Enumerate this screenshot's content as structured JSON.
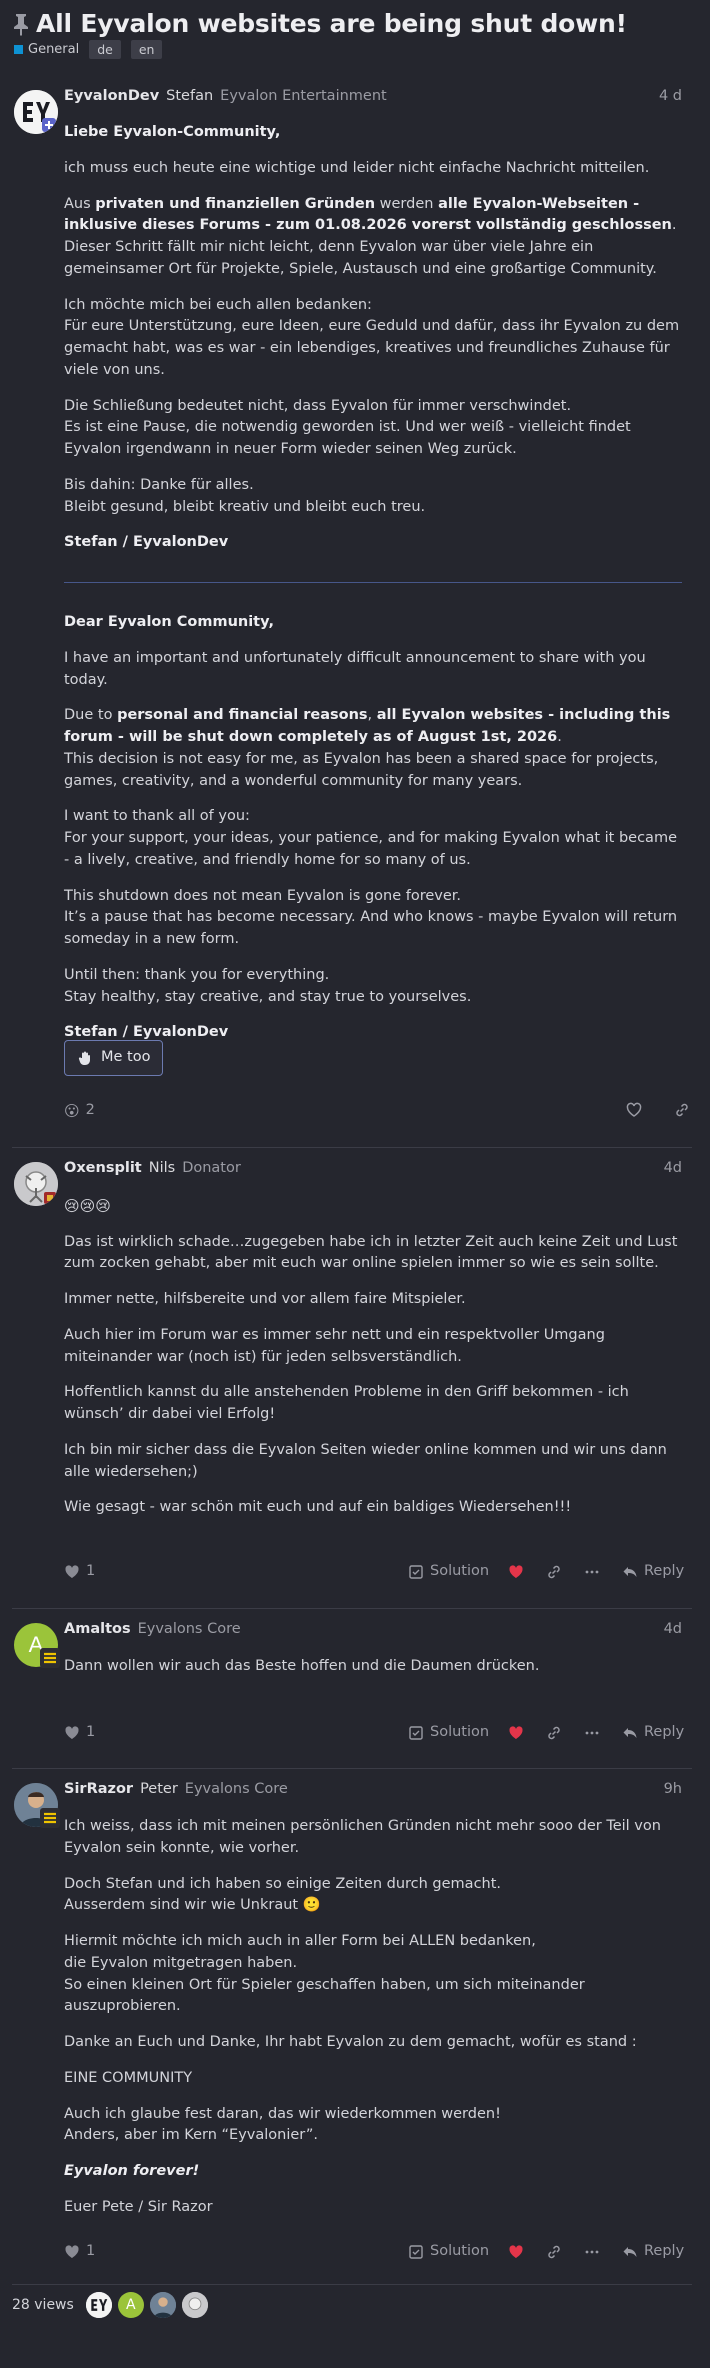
{
  "topic": {
    "title": "All Eyvalon websites are being shut down!",
    "category": "General",
    "tags": [
      "de",
      "en"
    ]
  },
  "posts": [
    {
      "username": "EyvalonDev",
      "realname": "Stefan",
      "group": "Eyvalon Entertainment",
      "date": "4 d",
      "de": {
        "greeting": "Liebe Eyvalon-Community,",
        "p1": "ich muss euch heute eine wichtige und leider nicht einfache Nachricht mitteilen.",
        "p2_a": "Aus ",
        "p2_b": "privaten und finanziellen Gründen",
        "p2_c": " werden ",
        "p2_d": "alle Eyvalon-Webseiten - inklusive dieses Forums - zum 01.08.2026 vorerst vollständig geschlossen",
        "p2_e": ".",
        "p2_f": "Dieser Schritt fällt mir nicht leicht, denn Eyvalon war über viele Jahre ein gemeinsamer Ort für Projekte, Spiele, Austausch und eine großartige Community.",
        "p3_a": "Ich möchte mich bei euch allen bedanken:",
        "p3_b": "Für eure Unterstützung, eure Ideen, eure Geduld und dafür, dass ihr Eyvalon zu dem gemacht habt, was es war - ein lebendiges, kreatives und freundliches Zuhause für viele von uns.",
        "p4_a": "Die Schließung bedeutet nicht, dass Eyvalon für immer verschwindet.",
        "p4_b": "Es ist eine Pause, die notwendig geworden ist. Und wer weiß - vielleicht findet Eyvalon irgendwann in neuer Form wieder seinen Weg zurück.",
        "p5_a": "Bis dahin: Danke für alles.",
        "p5_b": "Bleibt gesund, bleibt kreativ und bleibt euch treu.",
        "sign": "Stefan / EyvalonDev"
      },
      "en": {
        "greeting": "Dear Eyvalon Community,",
        "p1": "I have an important and unfortunately difficult announcement to share with you today.",
        "p2_a": "Due to ",
        "p2_b": "personal and financial reasons",
        "p2_c": ", ",
        "p2_d": "all Eyvalon websites - including this forum - will be shut down completely as of August 1st, 2026",
        "p2_e": ".",
        "p2_f": "This decision is not easy for me, as Eyvalon has been a shared space for projects, games, creativity, and a wonderful community for many years.",
        "p3_a": "I want to thank all of you:",
        "p3_b": "For your support, your ideas, your patience, and for making Eyvalon what it became - a lively, creative, and friendly home for so many of us.",
        "p4_a": "This shutdown does not mean Eyvalon is gone forever.",
        "p4_b": "It’s a pause that has become necessary. And who knows - maybe Eyvalon will return someday in a new form.",
        "p5_a": "Until then: thank you for everything.",
        "p5_b": "Stay healthy, stay creative, and stay true to yourselves.",
        "sign": "Stefan / EyvalonDev"
      },
      "me_too": "Me too",
      "reaction_count": "2"
    },
    {
      "username": "Oxensplit",
      "realname": "Nils",
      "group": "Donator",
      "date": "4d",
      "emojis": "😢😢😢",
      "paragraphs": [
        "Das ist wirklich schade…zugegeben habe ich in letzter Zeit auch keine Zeit und Lust zum zocken gehabt, aber mit euch war online spielen immer so wie es sein sollte.",
        "Immer nette, hilfsbereite und vor allem faire Mitspieler.",
        "Auch hier im Forum war es immer sehr nett und ein respektvoller Umgang miteinander war (noch ist) für jeden selbsverständlich.",
        "Hoffentlich kannst du alle anstehenden Probleme in den Griff bekommen - ich wünsch’ dir dabei viel Erfolg!",
        "Ich bin mir sicher dass die Eyvalon Seiten wieder online kommen und wir uns dann alle wiedersehen;)",
        "Wie gesagt - war schön mit euch und auf ein baldiges Wiedersehen!!!"
      ],
      "likes": "1"
    },
    {
      "username": "Amaltos",
      "realname": "",
      "group": "Eyvalons Core",
      "date": "4d",
      "avatar_letter": "A",
      "paragraphs": [
        "Dann wollen wir auch das Beste hoffen und die Daumen drücken."
      ],
      "likes": "1"
    },
    {
      "username": "SirRazor",
      "realname": "Peter",
      "group": "Eyvalons Core",
      "date": "9h",
      "p1": "Ich weiss, dass ich mit meinen persönlichen Gründen nicht mehr sooo der Teil von Eyvalon sein konnte, wie vorher.",
      "p2_a": "Doch Stefan und ich haben so einige Zeiten durch gemacht.",
      "p2_b": "Ausserdem sind wir wie Unkraut 🙂",
      "p3_a": "Hiermit möchte ich mich auch in aller Form bei ALLEN bedanken,",
      "p3_b": "die Eyvalon mitgetragen haben.",
      "p3_c": "So einen kleinen Ort für Spieler geschaffen haben, um sich miteinander auszuprobieren.",
      "p4": "Danke an Euch und Danke, Ihr habt Eyvalon zu dem gemacht, wofür es stand :",
      "p5": "EINE COMMUNITY",
      "p6_a": "Auch ich glaube fest daran, das wir wiederkommen werden!",
      "p6_b": "Anders, aber im Kern “Eyvalonier”.",
      "p7": "Eyvalon forever!",
      "p8": "Euer Pete / Sir Razor",
      "likes": "1"
    }
  ],
  "actions": {
    "solution": "Solution",
    "reply": "Reply"
  },
  "footer": {
    "views": "28 views",
    "participant_letter": "A"
  },
  "colors": {
    "accent": "#0e92d3",
    "like_red": "#e4354a",
    "background": "#25262e"
  },
  "icons": [
    "pin-icon",
    "heart-icon",
    "link-icon",
    "more-icon",
    "reply-icon",
    "checkbox-icon",
    "hand-icon"
  ]
}
